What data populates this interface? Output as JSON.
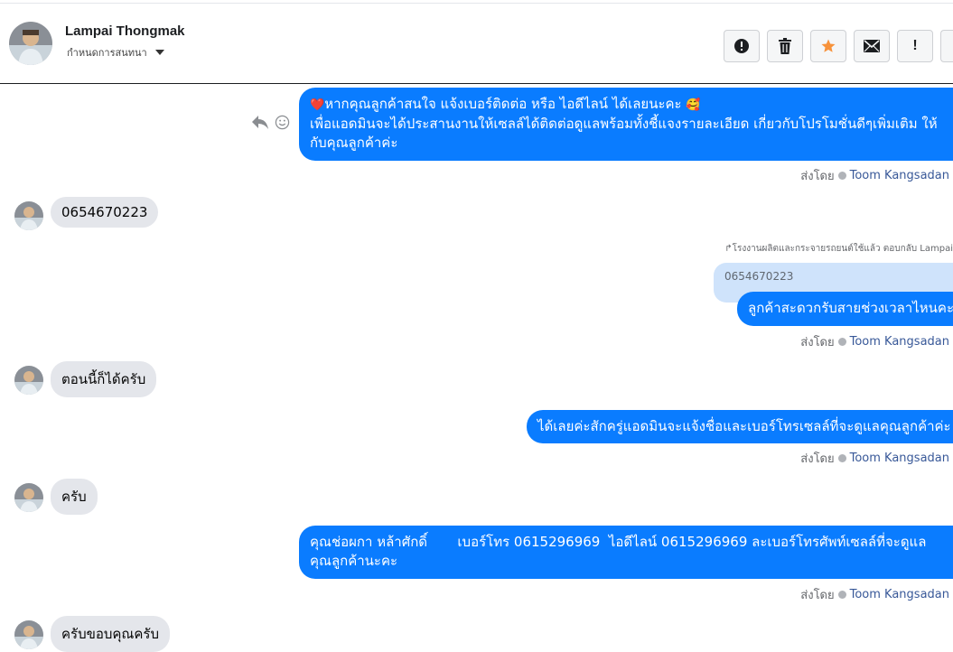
{
  "header": {
    "contact_name": "Lampai Thongmak",
    "assign_label": "กำหนดการสนทนา",
    "toolbar": [
      {
        "name": "spam-button",
        "icon": "alert-circle-icon"
      },
      {
        "name": "delete-button",
        "icon": "trash-icon"
      },
      {
        "name": "star-button",
        "icon": "star-icon",
        "color": "#f7923b"
      },
      {
        "name": "mark-unread-button",
        "icon": "envelope-icon"
      },
      {
        "name": "important-button",
        "icon": "exclamation-icon",
        "text": "!"
      }
    ]
  },
  "messages": [
    {
      "direction": "out",
      "heart": "❤️",
      "emoji": "🥰",
      "line1": "หากคุณลูกค้าสนใจ แจ้งเบอร์ติดต่อ หรือ ไอดีไลน์ ได้เลยนะคะ",
      "rest": "เพื่อแอดมินจะได้ประสานงานให้เซลล์ได้ติดต่อดูแลพร้อมทั้งชี้แจงรายละเอียด เกี่ยวกับโปรโมชั่นดีๆเพิ่มเติม ให้กับคุณลูกค้าค่ะ",
      "sent_by": "ส่งโดย",
      "agent": "Toom Kangsadan"
    },
    {
      "direction": "in",
      "text": "0654670223"
    },
    {
      "direction": "out",
      "reply_meta": "โรงงานผลิตและกระจายรถยนต์ใช้แล้ว ตอบกลับ Lampai",
      "quoted": "0654670223",
      "text": "ลูกค้าสะดวกรับสายช่วงเวลาไหนคะ",
      "sent_by": "ส่งโดย",
      "agent": "Toom Kangsadan"
    },
    {
      "direction": "in",
      "text": "ตอนนี้ก็ได้ครับ"
    },
    {
      "direction": "out",
      "text": "ได้เลยค่ะสักครู่แอดมินจะแจ้งชื่อและเบอร์โทรเซลล์ที่จะดูแลคุณลูกค้าค่ะ",
      "sent_by": "ส่งโดย",
      "agent": "Toom Kangsadan"
    },
    {
      "direction": "in",
      "text": "ครับ"
    },
    {
      "direction": "out",
      "text": "คุณช่อผกา หล้าศักดิ์       เบอร์โทร 0615296969  ไอดีไลน์ 0615296969 ละเบอร์โทรศัพท์เซลล์ที่จะดูแลคุณลูกค้านะคะ",
      "sent_by": "ส่งโดย",
      "agent": "Toom Kangsadan"
    },
    {
      "direction": "in",
      "text": "ครับขอบคุณครับ"
    }
  ]
}
